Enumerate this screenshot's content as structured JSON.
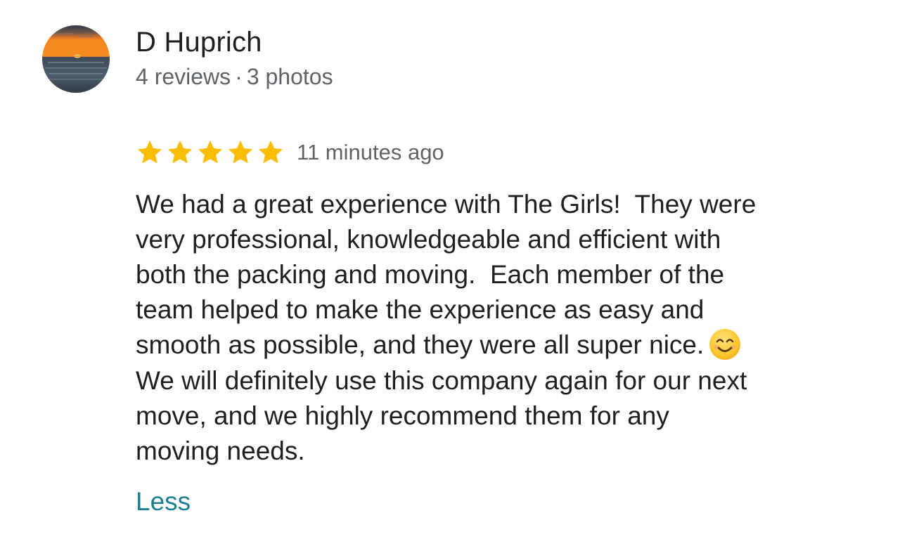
{
  "review": {
    "author": {
      "name": "D Huprich",
      "reviews": "4 reviews",
      "separator": "·",
      "photos": "3 photos",
      "avatar": "sunset-over-water-photo"
    },
    "rating": {
      "stars": 5,
      "max": 5,
      "star_color": "#fbbc04",
      "icon": "star-icon"
    },
    "time": "11 minutes ago",
    "text_lines": [
      "We had a great experience with The Girls!  They were",
      "very professional, knowledgeable and efficient with",
      "both the packing and moving.  Each member of the",
      "team helped to make the experience as easy and",
      "smooth as possible, and they were all super nice.",
      "We will definitely use this company again for our next",
      "move, and we highly recommend them for any",
      "moving needs."
    ],
    "emoji": "smiling-face-emoji",
    "less_label": "Less",
    "link_color": "#1a7f92"
  }
}
